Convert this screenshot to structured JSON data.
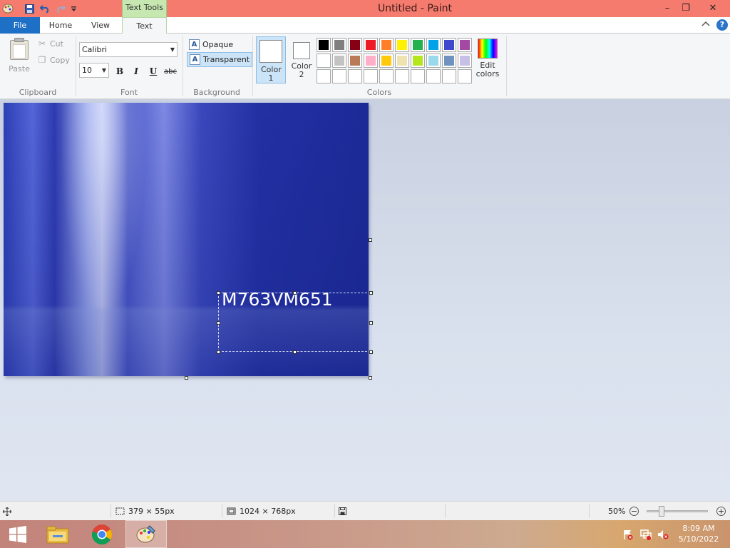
{
  "window": {
    "title": "Untitled - Paint",
    "context_tab": "Text Tools",
    "controls": {
      "minimize": "–",
      "restore": "❐",
      "close": "✕"
    }
  },
  "tabs": {
    "file": "File",
    "home": "Home",
    "view": "View",
    "text": "Text"
  },
  "clipboard": {
    "paste": "Paste",
    "cut": "Cut",
    "copy": "Copy",
    "group": "Clipboard"
  },
  "font": {
    "family": "Calibri",
    "size": "10",
    "bold": "B",
    "italic": "I",
    "underline": "U",
    "strike": "abc",
    "group": "Font"
  },
  "background": {
    "opaque": "Opaque",
    "transparent": "Transparent",
    "group": "Background",
    "selected": "transparent"
  },
  "colors": {
    "color1_label": "Color 1",
    "color2_label": "Color 2",
    "edit_label": "Edit colors",
    "group": "Colors",
    "palette_row1": [
      "#000000",
      "#7f7f7f",
      "#880015",
      "#ed1c24",
      "#ff7f27",
      "#fff200",
      "#22b14c",
      "#00a2e8",
      "#3f48cc",
      "#a349a4"
    ],
    "palette_row2": [
      "#ffffff",
      "#c3c3c3",
      "#b97a57",
      "#ffaec9",
      "#ffc90e",
      "#efe4b0",
      "#b5e61d",
      "#99d9ea",
      "#7092be",
      "#c8bfe7"
    ],
    "palette_row3": [
      "#ffffff",
      "#ffffff",
      "#ffffff",
      "#ffffff",
      "#ffffff",
      "#ffffff",
      "#ffffff",
      "#ffffff",
      "#ffffff",
      "#ffffff"
    ]
  },
  "canvas": {
    "text": "M763VM651"
  },
  "status": {
    "selection_size": "379 × 55px",
    "image_size": "1024 × 768px",
    "zoom": "50%"
  },
  "taskbar": {
    "time": "8:09 AM",
    "date": "5/10/2022"
  }
}
